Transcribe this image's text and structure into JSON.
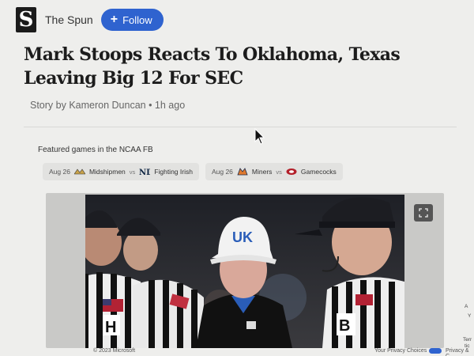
{
  "header": {
    "logo_letter": "S",
    "source_name": "The Spun",
    "follow_label": "Follow"
  },
  "article": {
    "title": "Mark Stoops Reacts To Oklahoma, Texas Leaving Big 12 For SEC",
    "byline": "Story by Kameron Duncan • 1h ago"
  },
  "featured": {
    "label": "Featured games in the NCAA FB",
    "games": [
      {
        "date": "Aug 26",
        "team1": "Midshipmen",
        "vs": "vs",
        "team2": "Fighting Irish"
      },
      {
        "date": "Aug 26",
        "team1": "Miners",
        "vs": "vs",
        "team2": "Gamecocks"
      }
    ]
  },
  "photo": {
    "cap_logo": "UK",
    "jersey_letter_left": "H",
    "jersey_letter_right": "B"
  },
  "footer": {
    "copyright": "© 2023 Microsoft",
    "privacy_choices": "Your Privacy Choices",
    "privacy_cut": "Privacy & C"
  },
  "side_fragments": {
    "a": "A",
    "b": "Y",
    "c": "Terr",
    "d": "tic"
  },
  "colors": {
    "accent": "#2f63cf",
    "kentucky_blue": "#2a5db8"
  },
  "icons": [
    "plus-icon",
    "mouse-cursor-icon",
    "expand-icon",
    "privacy-toggle-icon"
  ]
}
